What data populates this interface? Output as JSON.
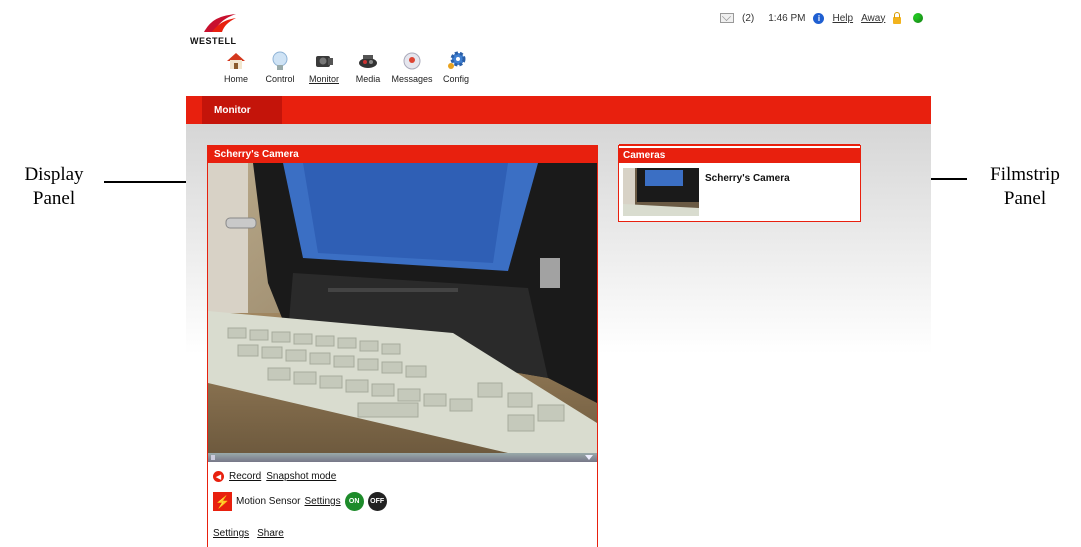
{
  "logo": {
    "text": "WESTELL"
  },
  "status": {
    "message_count": "(2)",
    "time": "1:46 PM",
    "help": "Help",
    "away": "Away"
  },
  "nav": {
    "items": [
      {
        "label": "Home",
        "icon": "house-icon"
      },
      {
        "label": "Control",
        "icon": "lightbulb-icon"
      },
      {
        "label": "Monitor",
        "icon": "camera-icon"
      },
      {
        "label": "Media",
        "icon": "media-icon"
      },
      {
        "label": "Messages",
        "icon": "messages-icon"
      },
      {
        "label": "Config",
        "icon": "gear-icon"
      }
    ]
  },
  "tabbar": {
    "active_tab": "Monitor"
  },
  "display_panel": {
    "title": "Scherry's Camera",
    "record": "Record",
    "snapshot": "Snapshot mode",
    "motion_sensor": "Motion Sensor",
    "motion_settings": "Settings",
    "on": "ON",
    "off": "OFF",
    "settings": "Settings",
    "share": "Share"
  },
  "filmstrip_panel": {
    "title": "Cameras",
    "camera_name": "Scherry's Camera"
  },
  "callouts": {
    "display_line1": "Display",
    "display_line2": "Panel",
    "filmstrip_line1": "Filmstrip",
    "filmstrip_line2": "Panel"
  },
  "colors": {
    "brand_red": "#e8200e",
    "on_green": "#1d8b2a"
  }
}
